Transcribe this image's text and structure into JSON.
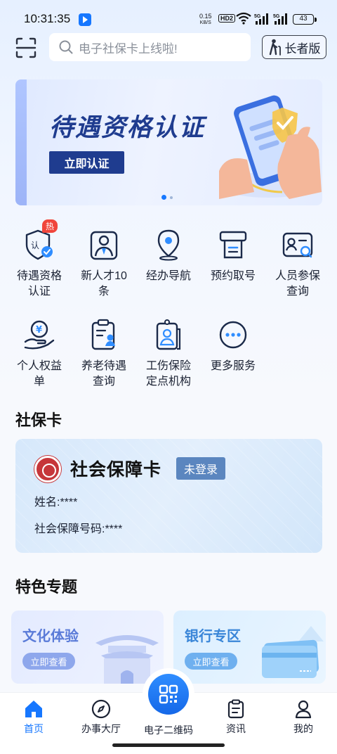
{
  "status_bar": {
    "time": "10:31:35",
    "net_speed_value": "0.15",
    "net_speed_unit": "KB/S",
    "hd": "HD2",
    "sig1": "5G",
    "sig2": "5G",
    "battery": "43"
  },
  "header": {
    "search_placeholder": "电子社保卡上线啦!",
    "elder_mode_label": "长者版"
  },
  "banner": {
    "title": "待遇资格认证",
    "button_label": "立即认证",
    "page_count": 2,
    "active_page": 1
  },
  "services": [
    {
      "label": "待遇资格认证",
      "label_lines": [
        "待遇资格",
        "认证"
      ],
      "icon": "shield-check-icon",
      "badge": "热"
    },
    {
      "label": "新人才10条",
      "label_lines": [
        "新人才10",
        "条"
      ],
      "icon": "person-badge-icon"
    },
    {
      "label": "经办导航",
      "label_lines": [
        "经办导航"
      ],
      "icon": "location-pin-icon"
    },
    {
      "label": "预约取号",
      "label_lines": [
        "预约取号"
      ],
      "icon": "ticket-machine-icon"
    },
    {
      "label": "人员参保查询",
      "label_lines": [
        "人员参保",
        "查询"
      ],
      "icon": "id-card-search-icon"
    },
    {
      "label": "个人权益单",
      "label_lines": [
        "个人权益",
        "单"
      ],
      "icon": "hand-coin-icon"
    },
    {
      "label": "养老待遇查询",
      "label_lines": [
        "养老待遇",
        "查询"
      ],
      "icon": "clipboard-person-icon"
    },
    {
      "label": "工伤保险定点机构",
      "label_lines": [
        "工伤保险",
        "定点机构"
      ],
      "icon": "hospital-badge-icon"
    },
    {
      "label": "更多服务",
      "label_lines": [
        "更多服务"
      ],
      "icon": "more-dots-icon"
    }
  ],
  "social_card_section": {
    "title": "社保卡",
    "card_title": "社会保障卡",
    "status_badge": "未登录",
    "name_label": "姓名:",
    "name_value": "****",
    "number_label": "社会保障号码:",
    "number_value": "****"
  },
  "featured_section": {
    "title": "特色专题",
    "items": [
      {
        "title": "文化体验",
        "button": "立即查看"
      },
      {
        "title": "银行专区",
        "button": "立即查看"
      }
    ]
  },
  "bottom_nav": {
    "items": [
      {
        "label": "首页",
        "icon": "home-icon",
        "active": true
      },
      {
        "label": "办事大厅",
        "icon": "compass-icon",
        "active": false
      },
      {
        "label": "电子二维码",
        "icon": "qr-code-icon",
        "active": false
      },
      {
        "label": "资讯",
        "icon": "clipboard-icon",
        "active": false
      },
      {
        "label": "我的",
        "icon": "user-icon",
        "active": false
      }
    ]
  },
  "colors": {
    "accent": "#1677ff",
    "banner_title": "#1f3c8f",
    "hot_badge": "#f0453b",
    "card_badge": "#5b86bf",
    "culture_title": "#5a7bd8",
    "bank_title": "#3a86d8"
  }
}
